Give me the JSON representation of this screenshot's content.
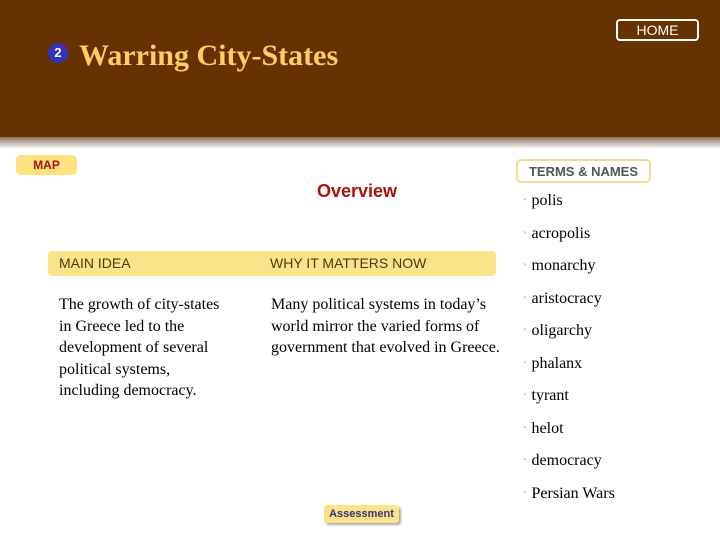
{
  "header": {
    "section_number": "2",
    "title": "Warring City-States",
    "home_label": "HOME"
  },
  "nav": {
    "map_label": "MAP",
    "assessment_label": "Assessment"
  },
  "overview": {
    "heading": "Overview"
  },
  "columns": {
    "main_idea_label": "MAIN IDEA",
    "why_label": "WHY IT MATTERS NOW",
    "main_idea_text": "The growth of city-states in Greece led to the development of several political systems, including democracy.",
    "why_text": "Many political systems in today’s world mirror the varied forms of government that evolved in Greece."
  },
  "terms": {
    "heading": "TERMS & NAMES",
    "bullet": "•",
    "items": [
      "polis",
      "acropolis",
      "monarchy",
      "aristocracy",
      "oligarchy",
      "phalanx",
      "tyrant",
      "helot",
      "democracy",
      "Persian Wars"
    ]
  },
  "colors": {
    "header_bg": "#663300",
    "title_color": "#ffcc66",
    "accent_yellow": "#fbe38a",
    "overview_red": "#aa1111",
    "badge_blue": "#3333bb"
  }
}
